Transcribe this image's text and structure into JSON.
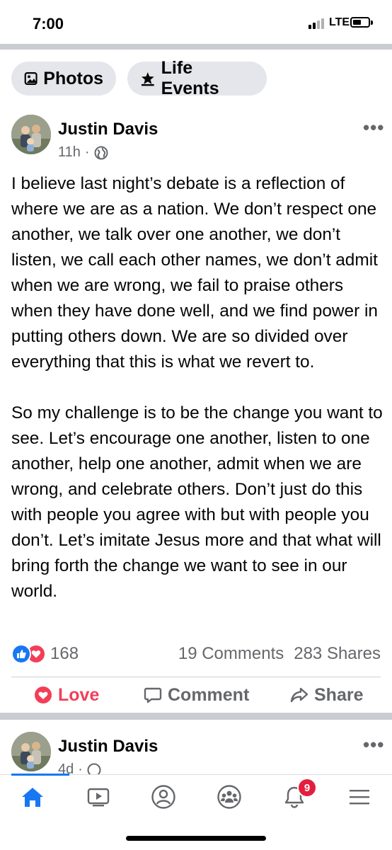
{
  "status_bar": {
    "time": "7:00",
    "network": "LTE"
  },
  "chips": {
    "photos": "Photos",
    "life_events": "Life Events"
  },
  "post": {
    "author": "Justin Davis",
    "time": "11h",
    "dot": "·",
    "more": "•••",
    "paragraphs": [
      "I believe last night’s debate is a reflection of where we are as a nation. We don’t respect one another, we talk over one another, we don’t listen, we call each other names, we don’t admit when we are wrong, we fail to praise others when they have done well, and we find power in putting others down. We are so divided over everything that this is what we revert to.",
      "So my challenge is to be the change you want to see. Let’s encourage one another, listen to one another, help one another, admit when we are wrong, and celebrate others. Don’t just do this with people you agree with but with people you don’t. Let’s imitate Jesus more and that what will bring forth the change we want to see in our world."
    ],
    "reaction_count": "168",
    "comments": "19 Comments",
    "shares": "283 Shares",
    "actions": {
      "love": "Love",
      "comment": "Comment",
      "share": "Share"
    }
  },
  "next_post": {
    "author": "Justin Davis",
    "time": "4d",
    "dot": "·",
    "more": "•••"
  },
  "tabbar": {
    "items": [
      "home-icon",
      "watch-icon",
      "profile-icon",
      "groups-icon",
      "notifications-icon",
      "menu-icon"
    ],
    "notification_badge": "9"
  },
  "colors": {
    "accent": "#1877f2",
    "love": "#f33e58",
    "badge": "#e41e3f",
    "muted": "#65676b"
  }
}
